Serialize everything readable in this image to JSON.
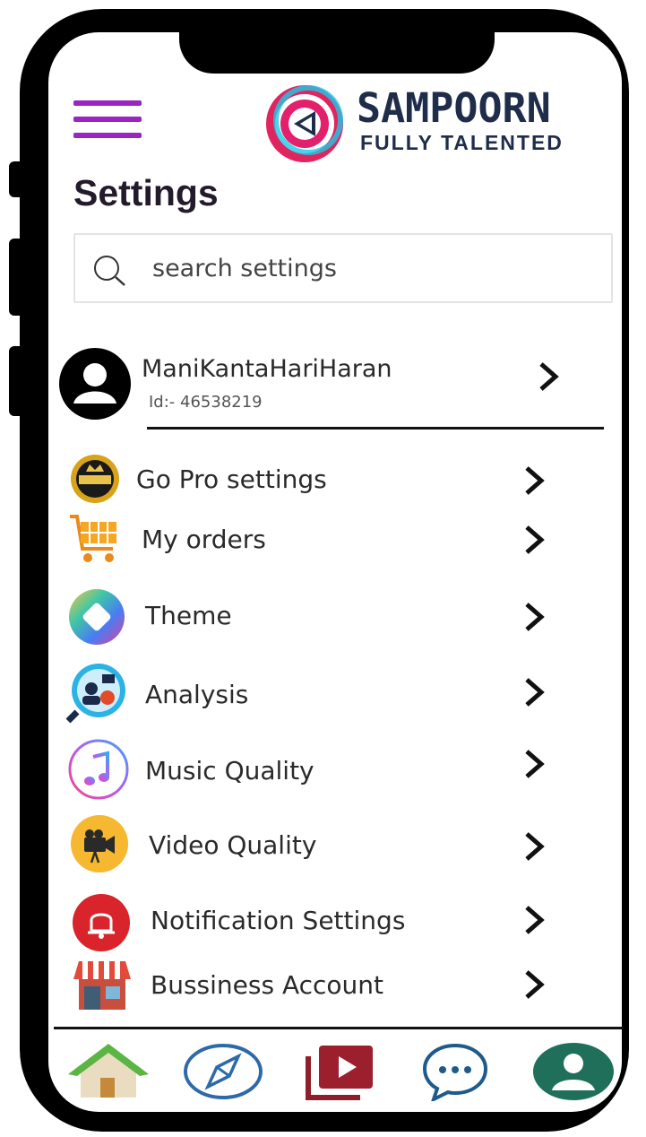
{
  "header": {
    "logo_title": "SAMPOORN",
    "logo_subtitle": "FULLY TALENTED"
  },
  "page_title": "Settings",
  "search": {
    "placeholder": "search settings"
  },
  "profile": {
    "name": "ManiKantaHariHaran",
    "id_text": "Id:- 46538219"
  },
  "menu": [
    {
      "label": "Go Pro settings",
      "icon": "premium-badge-icon"
    },
    {
      "label": "My orders",
      "icon": "shopping-cart-icon"
    },
    {
      "label": "Theme",
      "icon": "theme-icon"
    },
    {
      "label": "Analysis",
      "icon": "analysis-icon"
    },
    {
      "label": "Music Quality",
      "icon": "music-note-icon"
    },
    {
      "label": "Video Quality",
      "icon": "video-camera-icon"
    },
    {
      "label": "Notification Settings",
      "icon": "bell-icon"
    },
    {
      "label": "Bussiness Account",
      "icon": "shop-icon"
    }
  ],
  "bottom_nav": [
    "home-icon",
    "compass-icon",
    "video-library-icon",
    "chat-icon",
    "profile-icon"
  ],
  "colors": {
    "accent_purple": "#9b24c4",
    "logo_navy": "#1f2d4a",
    "nav_teal": "#1f6f5a"
  }
}
